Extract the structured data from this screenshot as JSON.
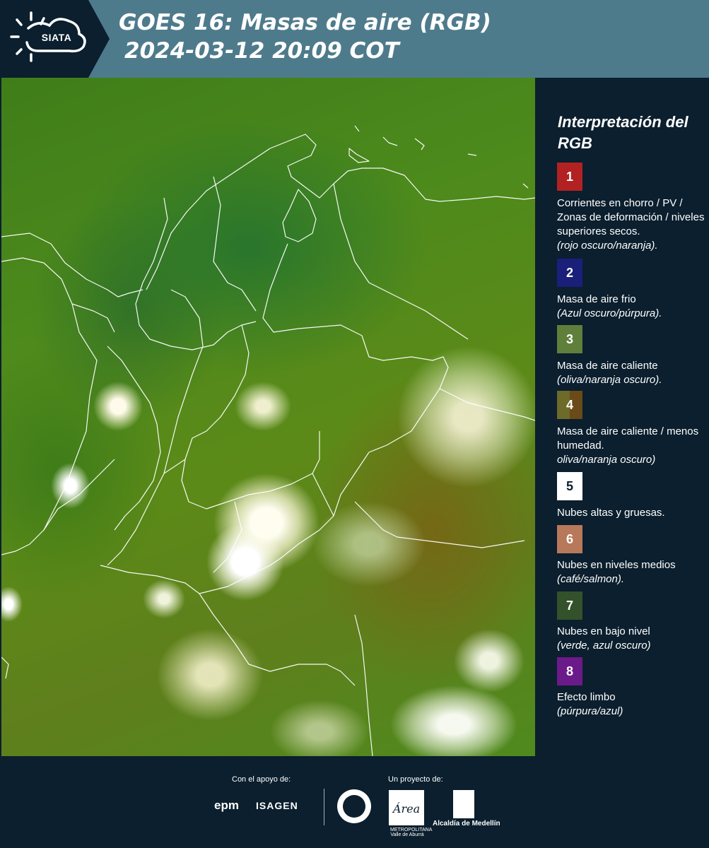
{
  "header": {
    "logo_text": "SIATA",
    "title_line1": "GOES 16: Masas de aire (RGB)",
    "title_line2": "2024-03-12 20:09 COT"
  },
  "map": {
    "description_icon": "satellite-map"
  },
  "legend": {
    "title": "Interpretación del RGB",
    "items": [
      {
        "number": "1",
        "color": "#b22222",
        "text": "Corrientes en chorro / PV / Zonas de deformación / niveles superiores secos.",
        "note": "(rojo oscuro/naranja)."
      },
      {
        "number": "2",
        "color": "#1a1f7a",
        "text": "Masa de aire frio",
        "note": "(Azul oscuro/púrpura)."
      },
      {
        "number": "3",
        "color": "#5f7f3a",
        "text": "Masa de aire caliente",
        "note": "(oliva/naranja oscuro)."
      },
      {
        "number": "4",
        "color": "#6a5a22",
        "text": "Masa de aire caliente / menos humedad.",
        "note": "oliva/naranja oscuro)"
      },
      {
        "number": "5",
        "color": "#ffffff",
        "text": "Nubes altas y gruesas.",
        "note": ""
      },
      {
        "number": "6",
        "color": "#b8785a",
        "text": "Nubes en niveles medios",
        "note": "(café/salmon)."
      },
      {
        "number": "7",
        "color": "#33512a",
        "text": "Nubes en bajo nivel",
        "note": "(verde, azul oscuro)"
      },
      {
        "number": "8",
        "color": "#6b1a8a",
        "text": "Efecto limbo",
        "note": "(púrpura/azul)"
      }
    ]
  },
  "footer": {
    "support_label": "Con el apoyo de:",
    "project_label": "Un proyecto de:",
    "epm": "epm",
    "isagen": "ISAGEN",
    "amva_subtitle": "METROPOLITANA Valle de Aburrá",
    "amva_mark": "Área",
    "alcaldia": "Alcaldía de Medellín"
  }
}
